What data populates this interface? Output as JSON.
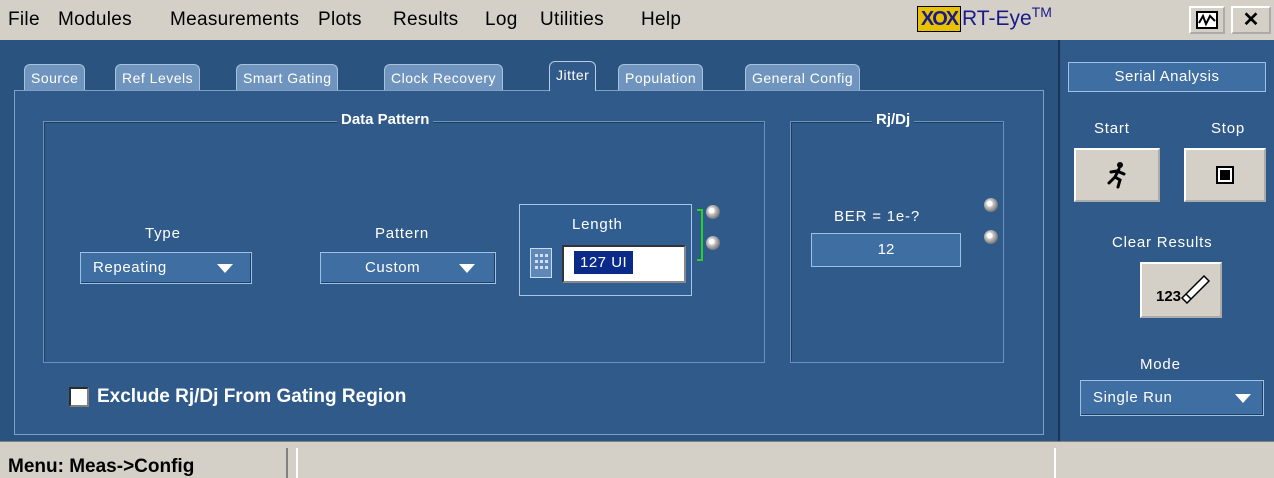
{
  "menu": {
    "items": [
      "File",
      "Modules",
      "Measurements",
      "Plots",
      "Results",
      "Log",
      "Utilities",
      "Help"
    ],
    "logo_text": "XOX",
    "app_name": "RT-Eye",
    "trademark": "TM"
  },
  "tabs": {
    "source": "Source",
    "ref_levels": "Ref Levels",
    "smart_gating": "Smart Gating",
    "clock_recovery": "Clock Recovery",
    "jitter": "Jitter",
    "population": "Population",
    "general_config": "General Config"
  },
  "data_pattern": {
    "title": "Data Pattern",
    "type_label": "Type",
    "type_value": "Repeating",
    "pattern_label": "Pattern",
    "pattern_value": "Custom",
    "length_label": "Length",
    "length_value": "127 UI"
  },
  "rjdj": {
    "title": "Rj/Dj",
    "ber_label": "BER = 1e-?",
    "ber_value": "12"
  },
  "exclude_checkbox": {
    "label": "Exclude Rj/Dj From Gating Region",
    "checked": false
  },
  "serial_analysis": {
    "title": "Serial Analysis",
    "start_label": "Start",
    "stop_label": "Stop",
    "clear_results_label": "Clear Results",
    "clear_icon_text": "123",
    "mode_label": "Mode",
    "mode_value": "Single Run"
  },
  "status": {
    "menu_path": "Menu: Meas->Config"
  },
  "colors": {
    "panel_bg": "#2f5a8a",
    "tab_bg": "#6f95bf",
    "dropdown_bg": "#3f6ea3",
    "length_input_bg": "#0a2a8a",
    "chrome": "#d4d0c8"
  }
}
